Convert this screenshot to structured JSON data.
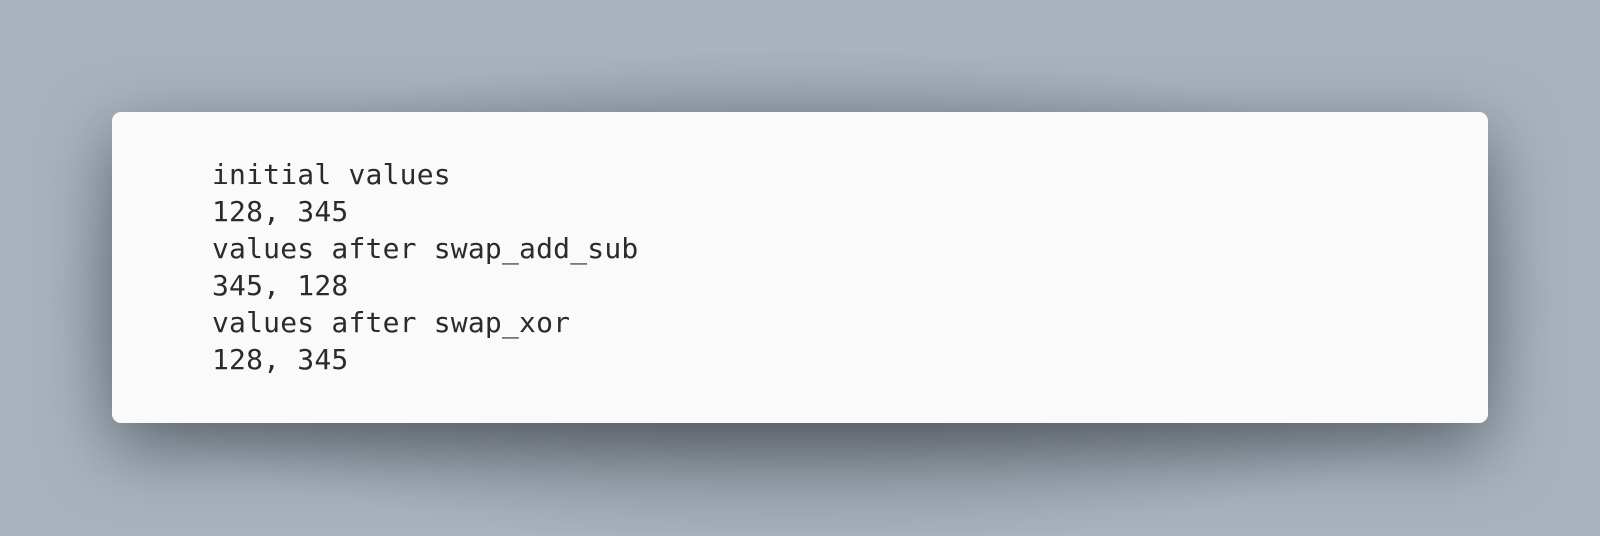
{
  "terminal_output": {
    "lines": [
      "initial values",
      "128, 345",
      "values after swap_add_sub",
      "345, 128",
      "values after swap_xor",
      "128, 345"
    ]
  }
}
